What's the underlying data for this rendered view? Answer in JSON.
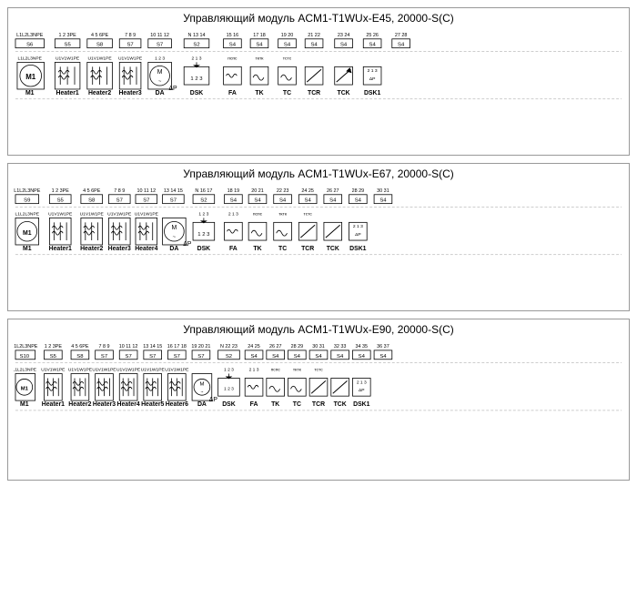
{
  "modules": [
    {
      "id": "e45",
      "title": "Управляющий модуль ACM1-T1WUx-E45, 20000-S(C)",
      "connectors_top": "L1|L2|L3|N|PE  1|2|3|PE  4|5|6|PE  7|8|9  10|11|12  N|13|14  15|16  17|18  19|20  21|22  23|24  25|26  27|28",
      "s_labels": [
        "S6",
        "S5",
        "S8",
        "S7",
        "S7",
        "S2",
        "S4",
        "S4",
        "S4",
        "S4",
        "S4",
        "S4",
        "S4"
      ],
      "equip_labels": [
        "M1",
        "Heater1",
        "Heater2",
        "Heater3",
        "DA",
        "DSK",
        "FA",
        "TK",
        "TC",
        "TCR",
        "TCK",
        "DSK1"
      ]
    },
    {
      "id": "e67",
      "title": "Управляющий модуль ACM1-T1WUx-E67, 20000-S(C)",
      "connectors_top": "L1|L2|L3|N|PE  1|2|3|PE  4|5|6|PE  7|8|9  10|11|12  13|14|15  N|16|17  18|19  20|21  22|23  24|25  26|27  28|29  30|31",
      "s_labels": [
        "S9",
        "S5",
        "S8",
        "S7",
        "S7",
        "S7",
        "S2",
        "S4",
        "S4",
        "S4",
        "S4",
        "S4",
        "S4",
        "S4"
      ],
      "equip_labels": [
        "M1",
        "Heater1",
        "Heater2",
        "Heater3",
        "Heater4",
        "DA",
        "DSK",
        "FA",
        "TK",
        "TC",
        "TCR",
        "TCK",
        "DSK1"
      ]
    },
    {
      "id": "e90",
      "title": "Управляющий модуль ACM1-T1WUx-E90, 20000-S(C)",
      "connectors_top": "L1|L2|L3|N|PE  1|2|3|PE  4|5|6|PE  7|8|9  10|11|12  13|14|15  16|17|18  19|20|21  N|22|23  24|25  26|27  28|29  30|31  32|33  34|35  36|37",
      "s_labels": [
        "S10",
        "S5",
        "S8",
        "S7",
        "S7",
        "S7",
        "S7",
        "S2",
        "S4",
        "S4",
        "S4",
        "S4",
        "S4",
        "S4",
        "S4"
      ],
      "equip_labels": [
        "M1",
        "Heater1",
        "Heater2",
        "Heater3",
        "Heater4",
        "Heater5",
        "Heater6",
        "DA",
        "DSK",
        "FA",
        "TK",
        "TC",
        "TCR",
        "TCK",
        "DSK1"
      ]
    }
  ]
}
